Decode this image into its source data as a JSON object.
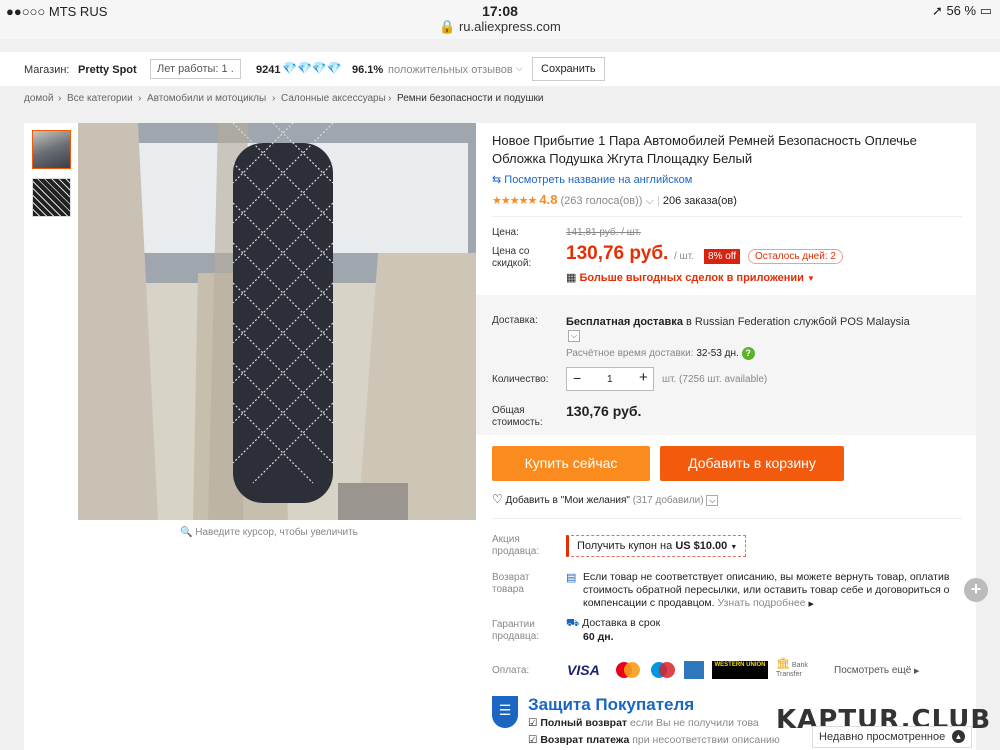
{
  "status": {
    "carrier": "●●○○○ MTS RUS",
    "time": "17:08",
    "battery": "56 %",
    "url": "ru.aliexpress.com"
  },
  "shop": {
    "label": "Магазин:",
    "name": "Pretty Spot",
    "years": "Лет работы: 1 .",
    "score": "9241",
    "positive_pct": "96.1%",
    "positive_text": "положительных отзывов",
    "save": "Сохранить"
  },
  "breadcrumb": [
    "домой",
    "Все категории",
    "Автомобили и мотоциклы",
    "Салонные аксессуары",
    "Ремни безопасности и подушки"
  ],
  "zoom_hint": "Наведите курсор, чтобы увеличить",
  "product": {
    "title": "Новое Прибытие 1 Пара Автомобилей Ремней Безопасность Оплечье Обложка Подушка Жгута Площадку Белый",
    "translate_link": "Посмотреть название на английском",
    "rating": "4.8",
    "rating_stars_value": 4.8,
    "votes": "(263 голоса(ов))",
    "orders": "206 заказа(ов)",
    "price_label": "Цена:",
    "price_old": "141,81 руб. / шт.",
    "discount_label": "Цена со скидкой:",
    "price_new": "130,76 руб.",
    "per_unit": "/ шт.",
    "discount_badge": "8% off",
    "days_left": "Осталось дней: 2",
    "app_deals": "Больше выгодных сделок в приложении",
    "shipping_label": "Доставка:",
    "shipping_free": "Бесплатная доставка",
    "shipping_in": "в",
    "shipping_country": "Russian Federation службой POS Malaysia",
    "eta_label": "Расчётное время доставки:",
    "eta_value": "32-53 дн.",
    "qty_label": "Количество:",
    "qty_value": "1",
    "qty_available": "шт. (7256 шт. available)",
    "total_label": "Общая стоимость:",
    "total_value": "130,76 руб.",
    "buy_now": "Купить сейчас",
    "add_cart": "Добавить в корзину",
    "wishlist": "Добавить в \"Мои желания\"",
    "wishlist_count": "(317 добавили)",
    "promo_label": "Акция продавца:",
    "coupon": "Получить купон на",
    "coupon_value": "US $10.00",
    "return_label": "Возврат товара",
    "return_text": "Если товар не соответствует описанию, вы можете вернуть товар, оплатив стоимость обратной пересылки, или оставить товар себе и договориться о компенсации с продавцом.",
    "return_link": "Узнать подробнее",
    "guarantee_label": "Гарантии продавца:",
    "guarantee_text": "Доставка в срок",
    "guarantee_days": "60 дн.",
    "payment_label": "Оплата:",
    "payments": [
      "VISA",
      "MasterCard",
      "Maestro",
      "AmEx",
      "WESTERN UNION",
      "Bank Transfer"
    ],
    "payments_more": "Посмотреть ещё",
    "protection_title": "Защита Покупателя",
    "protection_1_bold": "Полный возврат",
    "protection_1": "если Вы не получили това",
    "protection_2_bold": "Возврат платежа",
    "protection_2": "при несоответствии описанию"
  },
  "watermark": "KAPTUR.CLUB",
  "recent": "Недавно просмотренное",
  "colors": {
    "orange": "#f98b1f",
    "red_orange": "#f25a0e",
    "price_red": "#e62e04",
    "link_blue": "#1a66c2"
  }
}
